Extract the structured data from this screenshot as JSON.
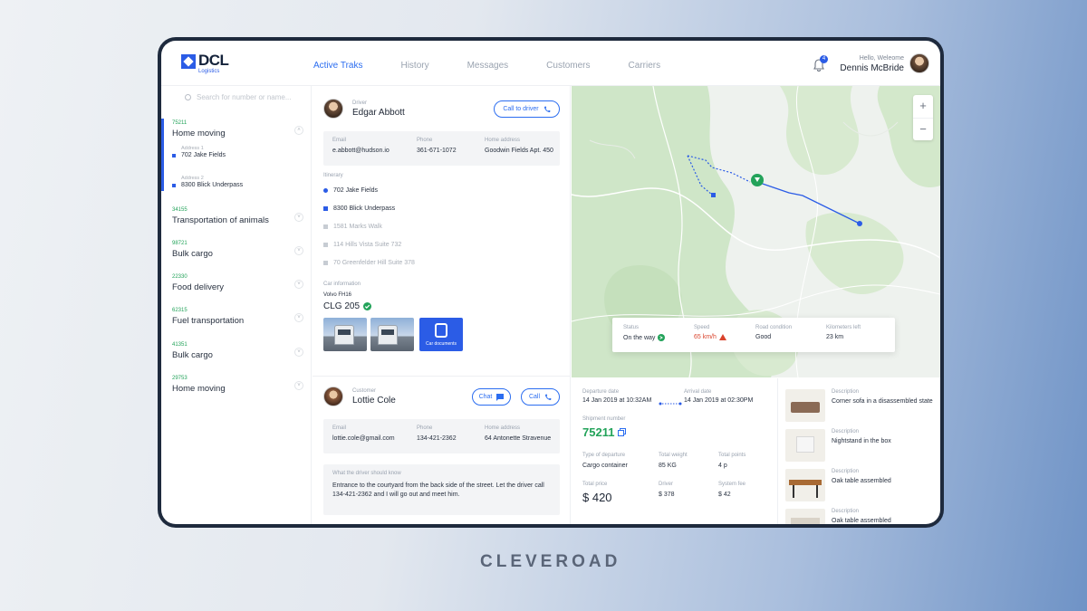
{
  "app": {
    "logo_name": "DCL",
    "logo_sub": "Logistics"
  },
  "nav": [
    "Active Traks",
    "History",
    "Messages",
    "Customers",
    "Carriers"
  ],
  "nav_active": 0,
  "header": {
    "notifications": "4",
    "greeting": "Hello, Weleome",
    "user_name": "Dennis McBride"
  },
  "search": {
    "placeholder": "Search for number or name..."
  },
  "orders": [
    {
      "id": "75211",
      "title": "Home moving"
    },
    {
      "id": "34155",
      "title": "Transportation of animals"
    },
    {
      "id": "98721",
      "title": "Bulk cargo"
    },
    {
      "id": "22330",
      "title": "Food delivery"
    },
    {
      "id": "62315",
      "title": "Fuel transportation"
    },
    {
      "id": "41351",
      "title": "Bulk cargo"
    },
    {
      "id": "29753",
      "title": "Home moving"
    }
  ],
  "active_addresses": [
    {
      "label": "Address 1",
      "value": "702 Jake Fields"
    },
    {
      "label": "Address 2",
      "value": "8300 Blick Underpass"
    }
  ],
  "driver": {
    "role": "Driver",
    "name": "Edgar Abbott",
    "call_label": "Call to driver",
    "email_label": "Email",
    "email": "e.abbott@hudson.io",
    "phone_label": "Phone",
    "phone": "361-671-1072",
    "address_label": "Home address",
    "address": "Goodwin Fields Apt. 450"
  },
  "itinerary": {
    "label": "Itinerary",
    "stops": [
      "702 Jake Fields",
      "8300 Blick Underpass",
      "1581 Marks Walk",
      "114 Hills Vista Suite 732",
      "70 Greenfelder Hill Suite 378"
    ],
    "done_count": 2
  },
  "car": {
    "label": "Car information",
    "model": "Volvo FH16",
    "plate": "CLG 205",
    "docs_label": "Car documents"
  },
  "customer": {
    "role": "Customer",
    "name": "Lottie Cole",
    "chat_label": "Chat",
    "call_label": "Call",
    "email_label": "Email",
    "email": "lottie.cole@gmail.com",
    "phone_label": "Phone",
    "phone": "134-421-2362",
    "address_label": "Home address",
    "address": "64 Antonette Stravenue",
    "note_label": "What the driver should know",
    "note": "Entrance to the courtyard from the back side of the street. Let the driver call 134-421-2362 and I will go out and meet him."
  },
  "map_status": {
    "status_label": "Status",
    "status": "On the way",
    "speed_label": "Speed",
    "speed": "65 km/h",
    "road_label": "Road condition",
    "road": "Good",
    "km_label": "Kilometers left",
    "km": "23 km"
  },
  "shipment": {
    "departure_label": "Departure date",
    "departure": "14 Jan 2019 at 10:32AM",
    "arrival_label": "Arrival date",
    "arrival": "14 Jan 2019 at 02:30PM",
    "number_label": "Shipment number",
    "number": "75211",
    "type_label": "Type of departure",
    "type": "Cargo container",
    "weight_label": "Total weight",
    "weight": "85 KG",
    "points_label": "Total points",
    "points": "4 p",
    "price_label": "Total price",
    "price": "$ 420",
    "driver_label": "Driver",
    "driver_fee": "$ 378",
    "system_label": "System fee",
    "system_fee": "$ 42"
  },
  "cargo_items": [
    {
      "label": "Description",
      "text": "Corner sofa in a disassembled state"
    },
    {
      "label": "Description",
      "text": "Nightstand in the box"
    },
    {
      "label": "Description",
      "text": "Oak table assembled"
    },
    {
      "label": "Description",
      "text": "Oak table assembled"
    }
  ],
  "footer_brand": "CLEVEROAD",
  "colors": {
    "accent": "#2b5ce6",
    "green": "#23a35a",
    "red": "#d9432c",
    "frame": "#1e2a3d"
  }
}
